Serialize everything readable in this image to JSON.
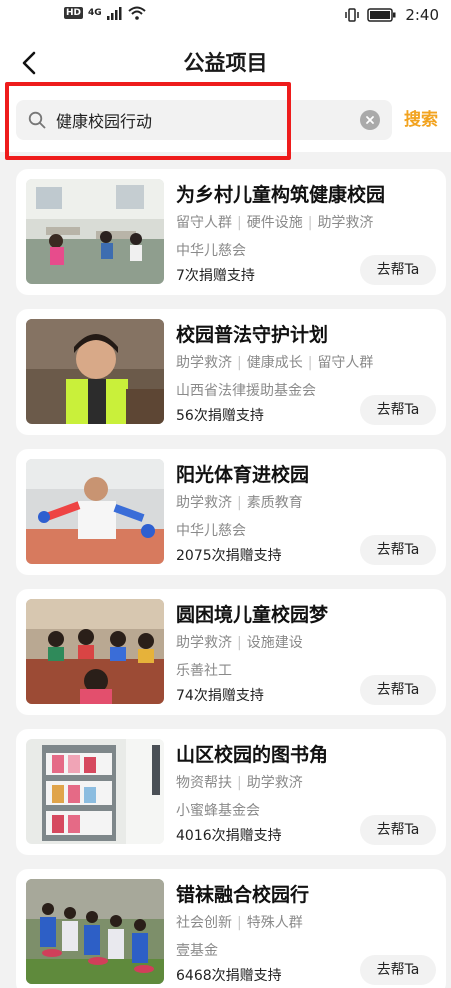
{
  "status_bar": {
    "network": "4G",
    "time": "2:40",
    "hd_badge": "HD"
  },
  "header": {
    "title": "公益项目"
  },
  "search": {
    "value": "健康校园行动",
    "button_label": "搜索"
  },
  "projects": [
    {
      "title": "为乡村儿童构筑健康校园",
      "tags": [
        "留守人群",
        "硬件设施",
        "助学救济"
      ],
      "org": "中华儿慈会",
      "count": "7次捐赠支持",
      "button": "去帮Ta"
    },
    {
      "title": "校园普法守护计划",
      "tags": [
        "助学救济",
        "健康成长",
        "留守人群"
      ],
      "org": "山西省法律援助基金会",
      "count": "56次捐赠支持",
      "button": "去帮Ta"
    },
    {
      "title": "阳光体育进校园",
      "tags": [
        "助学救济",
        "素质教育"
      ],
      "org": "中华儿慈会",
      "count": "2075次捐赠支持",
      "button": "去帮Ta"
    },
    {
      "title": "圆困境儿童校园梦",
      "tags": [
        "助学救济",
        "设施建设"
      ],
      "org": "乐善社工",
      "count": "74次捐赠支持",
      "button": "去帮Ta"
    },
    {
      "title": "山区校园的图书角",
      "tags": [
        "物资帮扶",
        "助学救济"
      ],
      "org": "小蜜蜂基金会",
      "count": "4016次捐赠支持",
      "button": "去帮Ta"
    },
    {
      "title": "错袜融合校园行",
      "tags": [
        "社会创新",
        "特殊人群"
      ],
      "org": "壹基金",
      "count": "6468次捐赠支持",
      "button": "去帮Ta"
    }
  ],
  "colors": {
    "accent": "#f2a31f",
    "highlight_border": "#ee1c1c",
    "page_bg": "#f2f2f2"
  }
}
